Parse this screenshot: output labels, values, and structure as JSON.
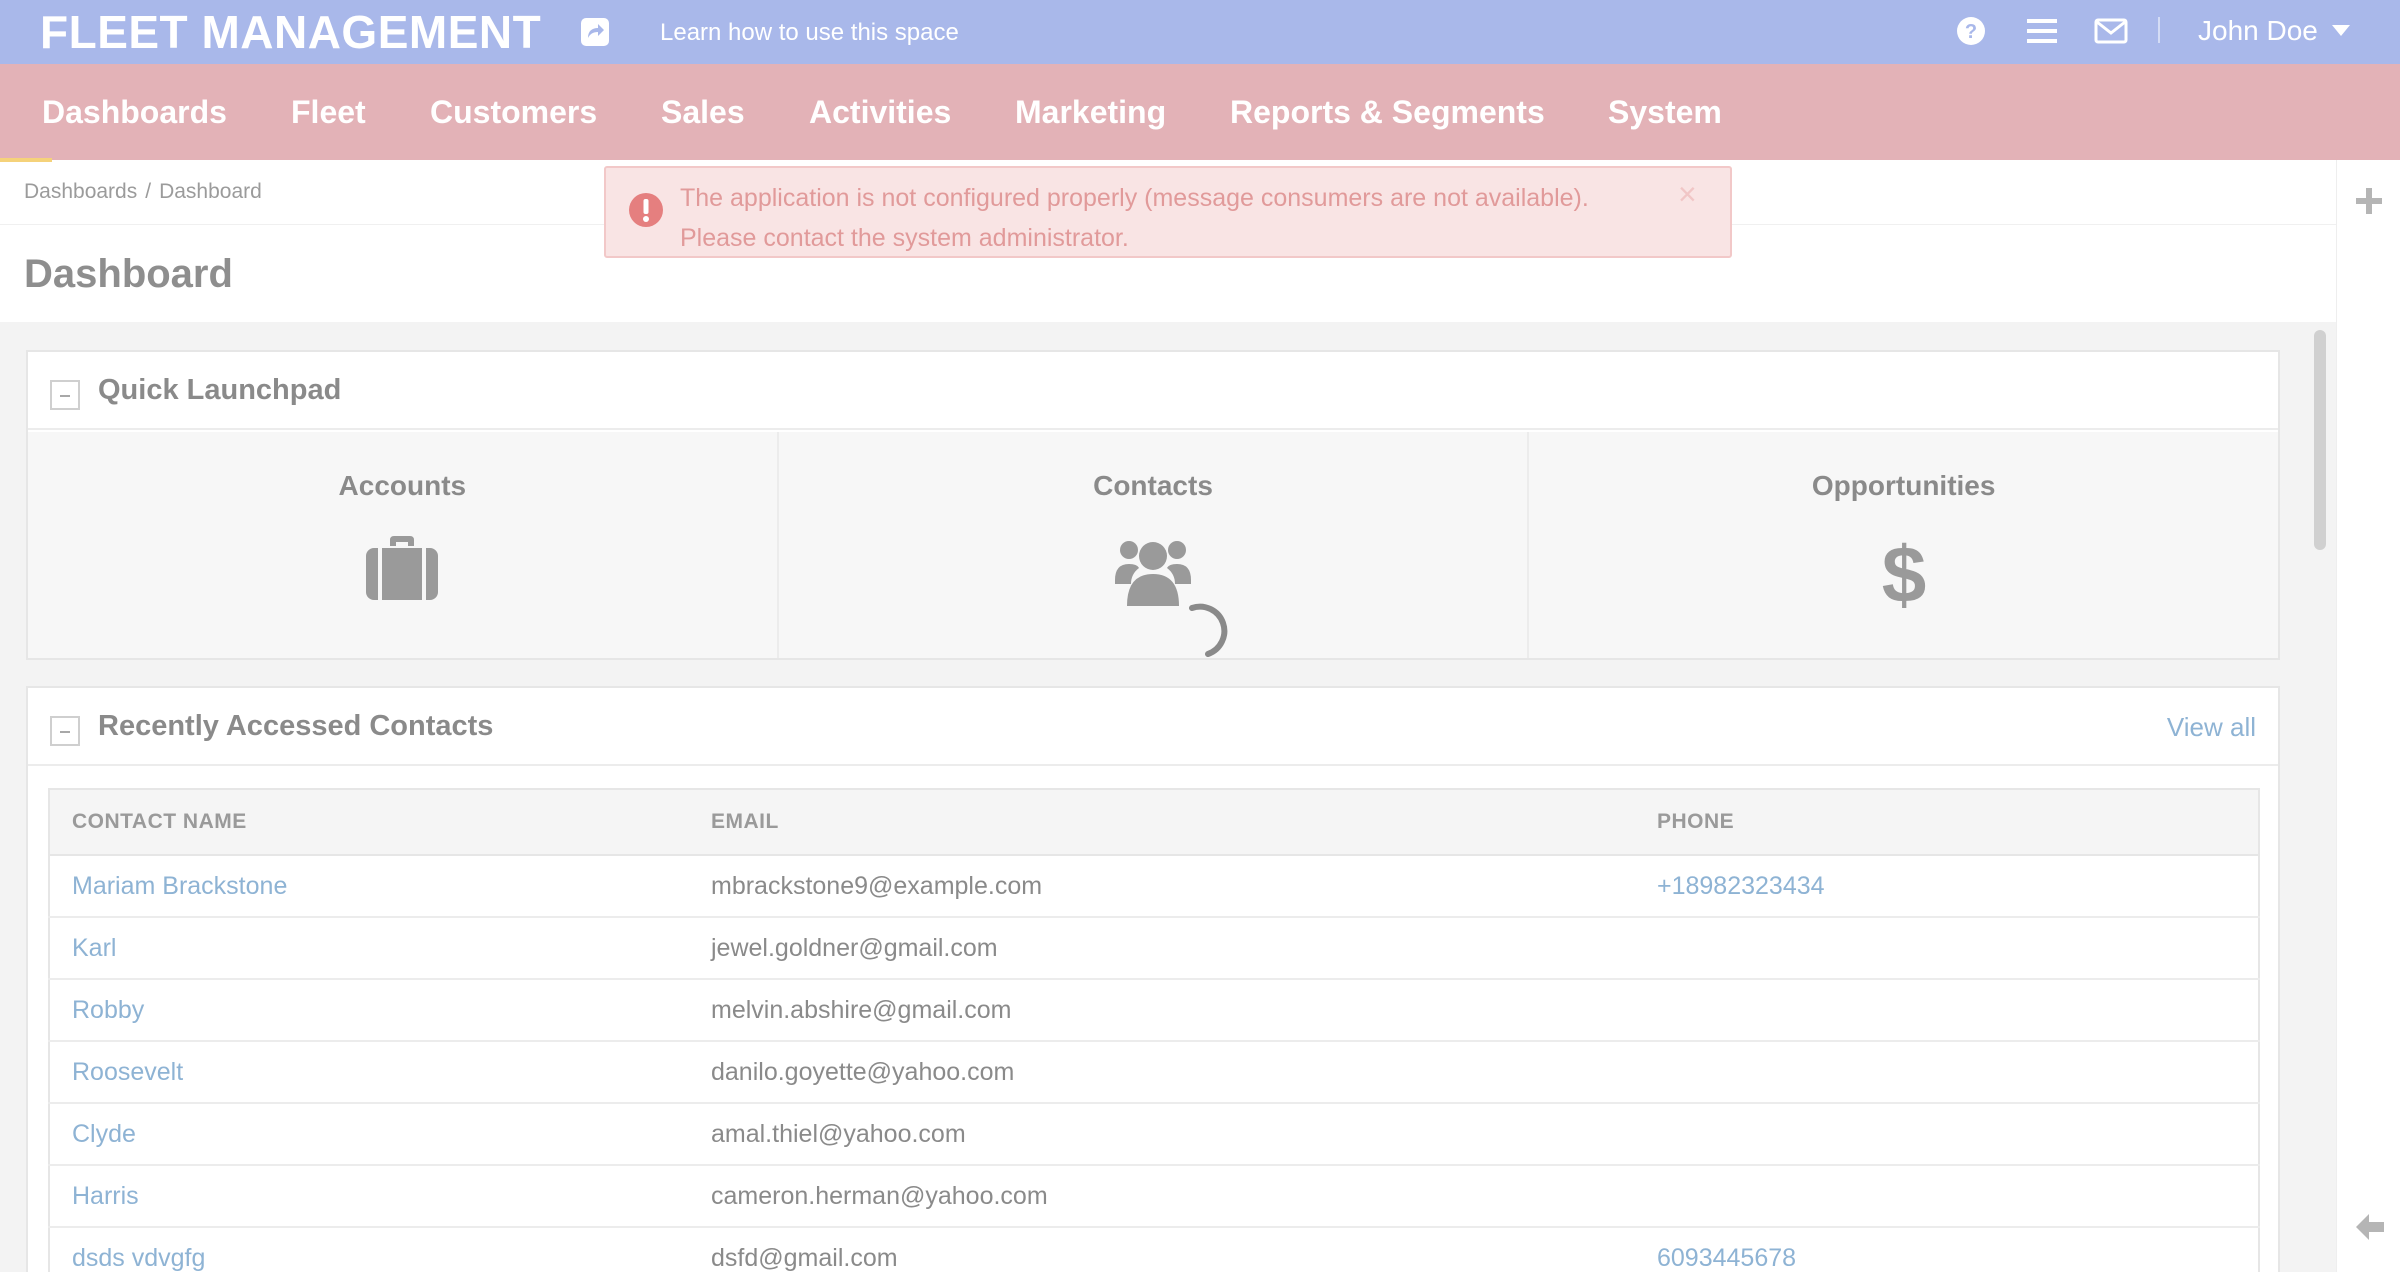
{
  "topbar": {
    "brand": "FLEET MANAGEMENT",
    "learn_link": "Learn how to use this space",
    "user_name": "John Doe",
    "icons": [
      "share-icon",
      "help-icon",
      "menu-icon",
      "mail-icon",
      "caret-down-icon"
    ]
  },
  "nav": {
    "items": [
      {
        "label": "Dashboards"
      },
      {
        "label": "Fleet"
      },
      {
        "label": "Customers"
      },
      {
        "label": "Sales"
      },
      {
        "label": "Activities"
      },
      {
        "label": "Marketing"
      },
      {
        "label": "Reports & Segments"
      },
      {
        "label": "System"
      }
    ]
  },
  "breadcrumb": {
    "items": [
      "Dashboards",
      "Dashboard"
    ],
    "separator": "/"
  },
  "page": {
    "title": "Dashboard"
  },
  "alert": {
    "line1": "The application is not configured properly (message consumers are not available).",
    "line2": "Please contact the system administrator.",
    "close": "×"
  },
  "launchpad": {
    "title": "Quick Launchpad",
    "tiles": [
      {
        "label": "Accounts",
        "icon": "briefcase-icon"
      },
      {
        "label": "Contacts",
        "icon": "users-icon"
      },
      {
        "label": "Opportunities",
        "icon": "dollar-icon"
      }
    ]
  },
  "contacts": {
    "title": "Recently Accessed Contacts",
    "view_all": "View all",
    "columns": [
      "CONTACT NAME",
      "EMAIL",
      "PHONE"
    ],
    "rows": [
      {
        "name": "Mariam Brackstone",
        "email": "mbrackstone9@example.com",
        "phone": "+18982323434"
      },
      {
        "name": "Karl",
        "email": "jewel.goldner@gmail.com",
        "phone": ""
      },
      {
        "name": "Robby",
        "email": "melvin.abshire@gmail.com",
        "phone": ""
      },
      {
        "name": "Roosevelt",
        "email": "danilo.goyette@yahoo.com",
        "phone": ""
      },
      {
        "name": "Clyde",
        "email": "amal.thiel@yahoo.com",
        "phone": ""
      },
      {
        "name": "Harris",
        "email": "cameron.herman@yahoo.com",
        "phone": ""
      },
      {
        "name": "dsds vdvgfg",
        "email": "dsfd@gmail.com",
        "phone": "6093445678"
      }
    ]
  },
  "colors": {
    "topbar": "#a9b8ea",
    "nav": "#e3b2b7",
    "alert_bg": "#f9e4e4",
    "alert_text": "#e19a9a",
    "link": "#8eb3d4"
  }
}
